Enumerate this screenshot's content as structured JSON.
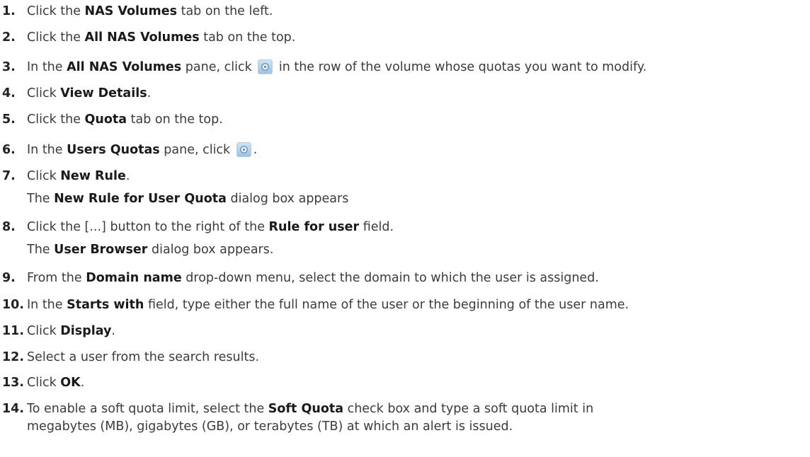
{
  "steps": [
    {
      "num": "1.",
      "t1": "Click the ",
      "b1": "NAS Volumes",
      "t2": " tab on the left."
    },
    {
      "num": "2.",
      "t1": "Click the ",
      "b1": "All NAS Volumes",
      "t2": " tab on the top."
    },
    {
      "num": "3.",
      "t1": "In the ",
      "b1": "All NAS Volumes",
      "t2": " pane, click ",
      "t3": " in the row of the volume whose quotas you want to modify."
    },
    {
      "num": "4.",
      "t1": "Click ",
      "b1": "View Details",
      "t2": "."
    },
    {
      "num": "5.",
      "t1": "Click the ",
      "b1": "Quota",
      "t2": " tab on the top."
    },
    {
      "num": "6.",
      "t1": "In the ",
      "b1": "Users Quotas",
      "t2": " pane, click ",
      "t3": "."
    },
    {
      "num": "7.",
      "t1": "Click ",
      "b1": "New Rule",
      "t2": "."
    },
    {
      "t1": "The ",
      "b1": "New Rule for User Quota",
      "t2": " dialog box appears"
    },
    {
      "num": "8.",
      "t1": "Click the [...] button to the right of the ",
      "b1": "Rule for user",
      "t2": " field."
    },
    {
      "t1": "The ",
      "b1": "User Browser",
      "t2": " dialog box appears."
    },
    {
      "num": "9.",
      "t1": "From the ",
      "b1": "Domain name",
      "t2": " drop-down menu, select the domain to which the user is assigned."
    },
    {
      "num": "10.",
      "t1": "In the ",
      "b1": "Starts with",
      "t2": " field, type either the full name of the user or the beginning of the user name."
    },
    {
      "num": "11.",
      "t1": "Click ",
      "b1": "Display",
      "t2": "."
    },
    {
      "num": "12.",
      "t1": "Select a user from the search results."
    },
    {
      "num": "13.",
      "t1": "Click ",
      "b1": "OK",
      "t2": "."
    },
    {
      "num": "14.",
      "t1": "To enable a soft quota limit, select the ",
      "b1": "Soft Quota",
      "t2": " check box and type a soft quota limit in"
    },
    {
      "t1": "megabytes (MB), gigabytes (GB), or terabytes (TB) at which an alert is issued."
    }
  ],
  "icons": {
    "gear": "gear-icon",
    "color": "#9cc3e4"
  }
}
